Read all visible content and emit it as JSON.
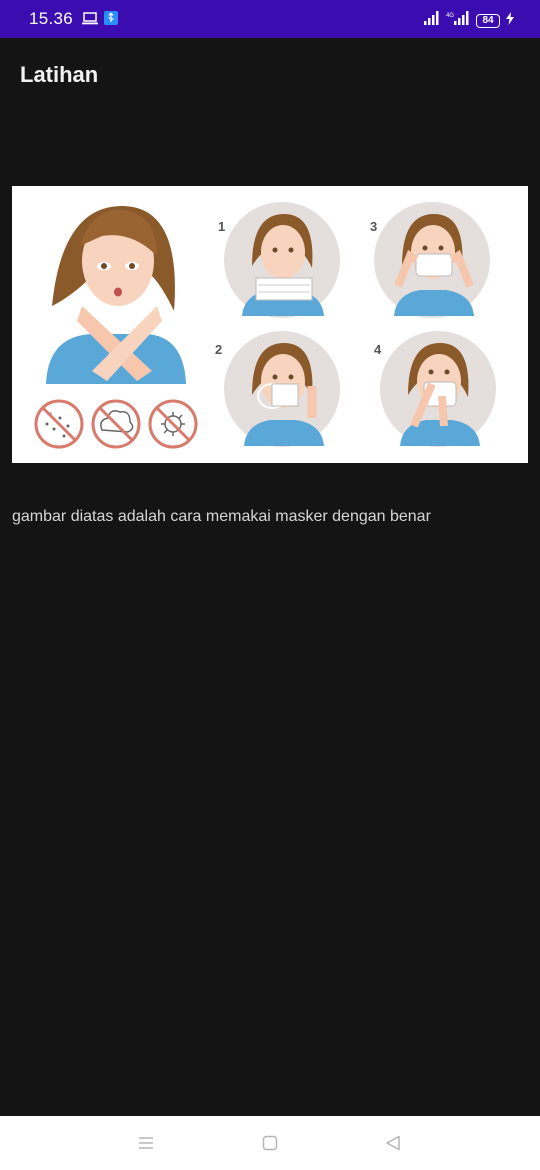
{
  "status_bar": {
    "time": "15.36",
    "battery_level": "84",
    "left_icons": [
      "laptop-icon",
      "usb-debug-icon"
    ],
    "right_icons": [
      "signal-icon",
      "4g-signal-icon",
      "battery-icon",
      "charging-icon"
    ]
  },
  "app_bar": {
    "title": "Latihan"
  },
  "main": {
    "caption": "gambar diatas adalah cara memakai masker dengan benar",
    "image": {
      "step_numbers": [
        "1",
        "2",
        "3",
        "4"
      ],
      "bottom_icons": [
        "no-droplets-icon",
        "no-cloud-icon",
        "no-virus-icon"
      ]
    }
  },
  "nav_bar": {
    "buttons": [
      "menu",
      "home",
      "back"
    ]
  },
  "colors": {
    "status_bar_bg": "#3b0db0",
    "page_bg": "#141414",
    "title_text": "#f2f2f2",
    "caption_text": "#d6d6d6",
    "nav_bar_bg": "#ffffff"
  }
}
